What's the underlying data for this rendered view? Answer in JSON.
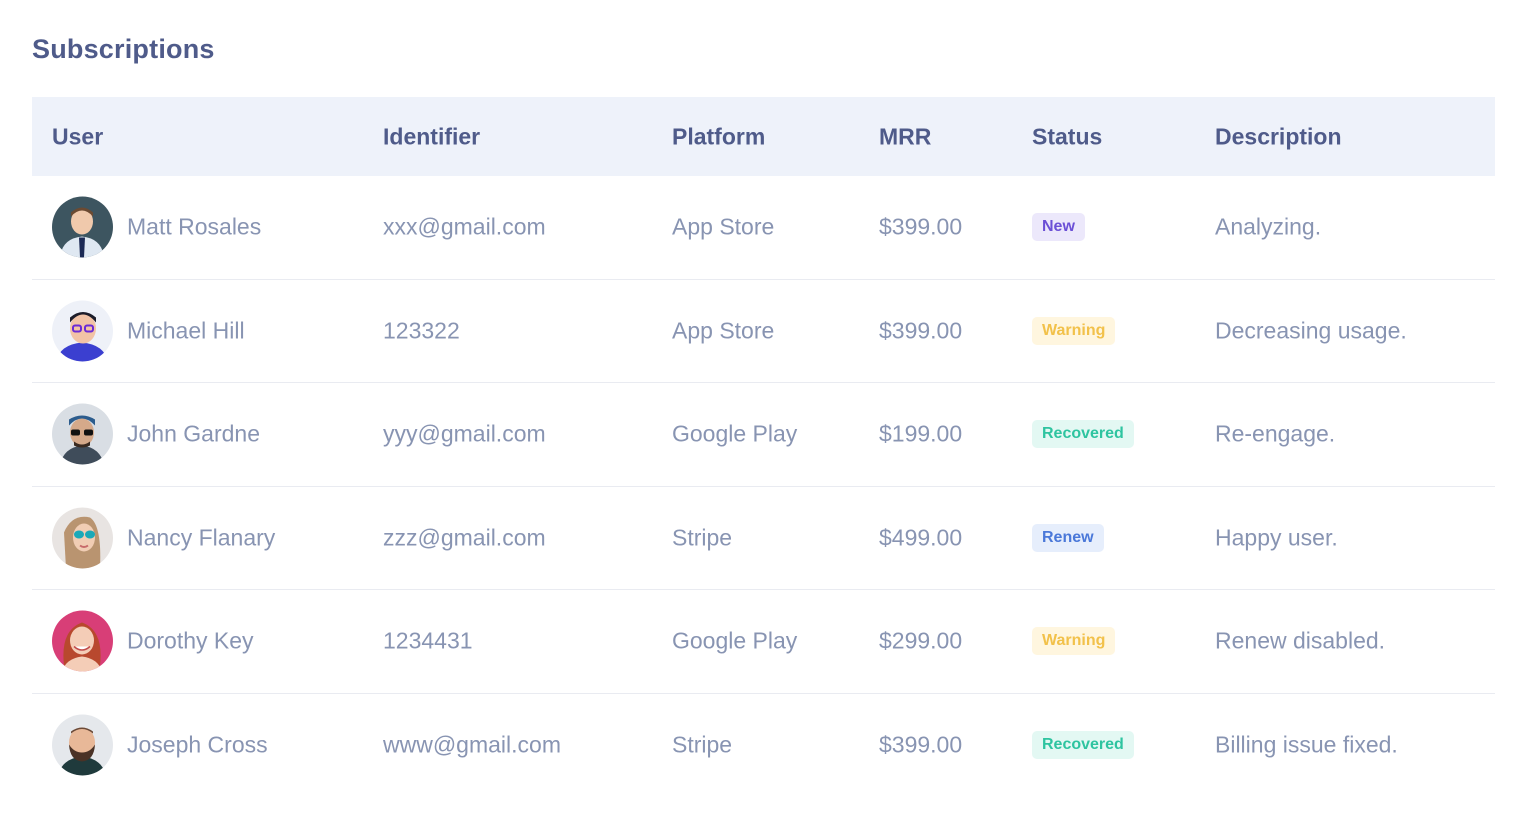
{
  "title": "Subscriptions",
  "columns": [
    "User",
    "Identifier",
    "Platform",
    "MRR",
    "Status",
    "Description"
  ],
  "status_colors": {
    "New": {
      "bg": "#ece8fb",
      "fg": "#6b4fd6"
    },
    "Warning": {
      "bg": "#fff6df",
      "fg": "#f2c14a"
    },
    "Recovered": {
      "bg": "#e3f8f3",
      "fg": "#2ec4a0"
    },
    "Renew": {
      "bg": "#e6eefc",
      "fg": "#4a78d9"
    }
  },
  "rows": [
    {
      "user": "Matt Rosales",
      "identifier": "xxx@gmail.com",
      "platform": "App Store",
      "mrr": "$399.00",
      "status": "New",
      "description": "Analyzing.",
      "avatar": "avatar-man-suit"
    },
    {
      "user": "Michael Hill",
      "identifier": "123322",
      "platform": "App Store",
      "mrr": "$399.00",
      "status": "Warning",
      "description": "Decreasing usage.",
      "avatar": "avatar-man-glasses"
    },
    {
      "user": "John Gardne",
      "identifier": "yyy@gmail.com",
      "platform": "Google Play",
      "mrr": "$199.00",
      "status": "Recovered",
      "description": "Re-engage.",
      "avatar": "avatar-man-sunglasses"
    },
    {
      "user": "Nancy Flanary",
      "identifier": "zzz@gmail.com",
      "platform": "Stripe",
      "mrr": "$499.00",
      "status": "Renew",
      "description": "Happy user.",
      "avatar": "avatar-woman-sunglasses"
    },
    {
      "user": "Dorothy Key",
      "identifier": "1234431",
      "platform": "Google Play",
      "mrr": "$299.00",
      "status": "Warning",
      "description": "Renew disabled.",
      "avatar": "avatar-woman-red-hair"
    },
    {
      "user": "Joseph Cross",
      "identifier": "www@gmail.com",
      "platform": "Stripe",
      "mrr": "$399.00",
      "status": "Recovered",
      "description": "Billing issue fixed.",
      "avatar": "avatar-man-beard"
    }
  ]
}
